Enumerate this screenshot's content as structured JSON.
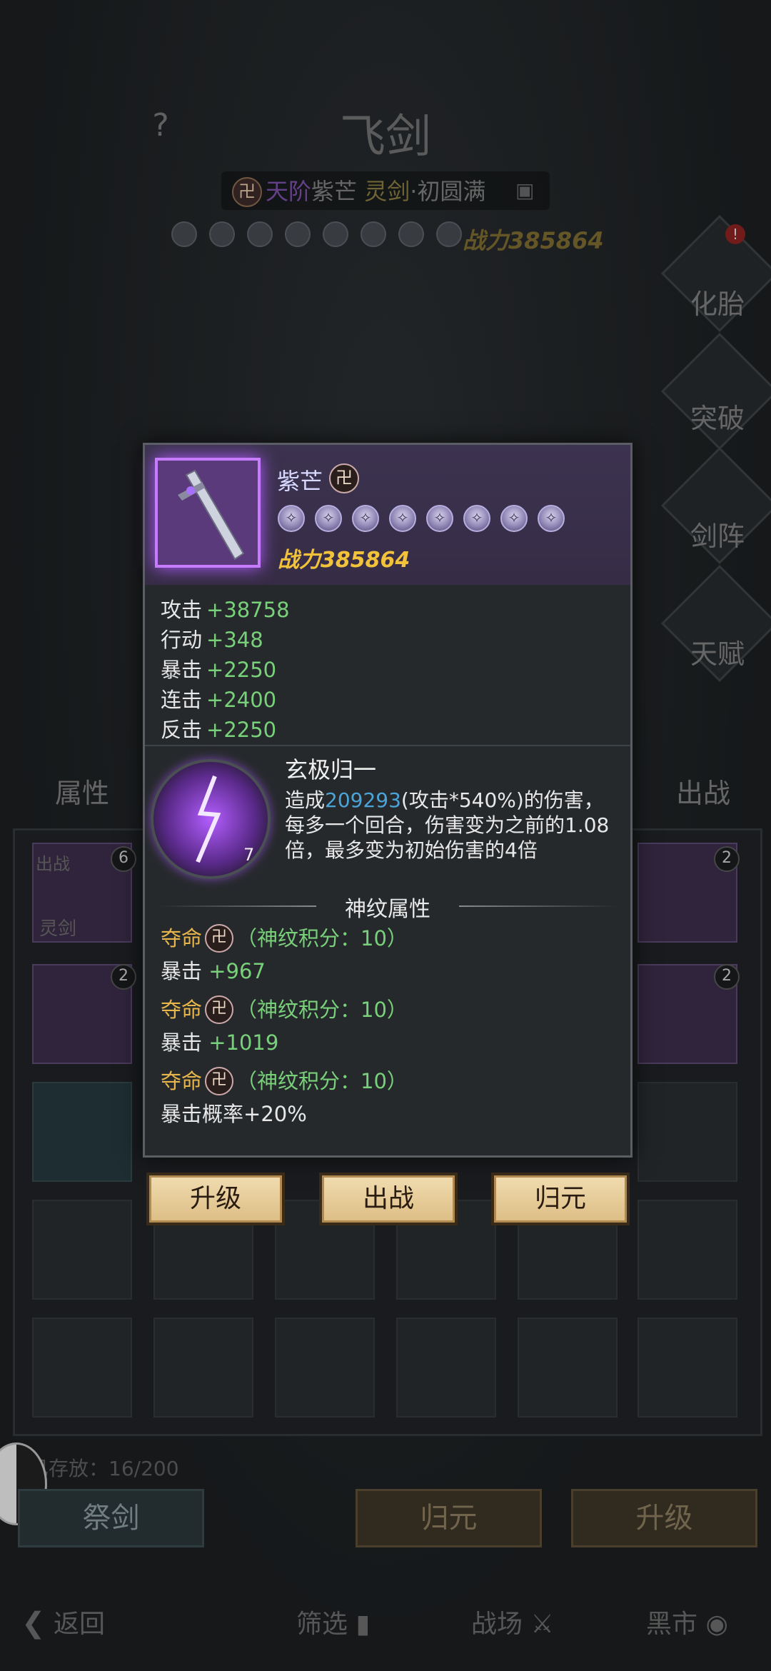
{
  "header": {
    "title": "飞剑",
    "help_label": "?",
    "rank_icon": "卍",
    "rank_parts": [
      "天阶",
      "紫芒",
      "灵剑",
      "·初圆满"
    ],
    "power": "战力385864"
  },
  "side_menu": [
    "化胎",
    "突破",
    "剑阵",
    "天赋"
  ],
  "tabs": {
    "left": "属性",
    "right": "出战"
  },
  "grid": {
    "slot_labels": [
      "出战",
      "灵剑"
    ],
    "badges": [
      "6",
      "2",
      "2",
      "2",
      "2",
      "2"
    ]
  },
  "storage": "已存放：16/200",
  "bottom_buttons": [
    "祭剑",
    "归元",
    "升级"
  ],
  "nav": [
    "返回",
    "筛选",
    "战场",
    "黑市"
  ],
  "popup": {
    "item": {
      "name": "紫芒",
      "icon_glyph": "卍",
      "stars_count": 8,
      "power": "战力385864"
    },
    "stats": [
      {
        "name": "攻击",
        "value": "+38758"
      },
      {
        "name": "行动",
        "value": "+348"
      },
      {
        "name": "暴击",
        "value": "+2250"
      },
      {
        "name": "连击",
        "value": "+2400"
      },
      {
        "name": "反击",
        "value": "+2250"
      }
    ],
    "skill": {
      "title": "玄极归一",
      "level": "7",
      "desc_prefix": "造成",
      "desc_value": "209293",
      "desc_suffix": "(攻击*540%)的伤害，每多一个回合，伤害变为之前的1.08倍，最多变为初始伤害的4倍"
    },
    "rune_section_title": "神纹属性",
    "runes": [
      {
        "name": "夺命",
        "score": "（神纹积分：10）",
        "stat": "暴击",
        "value": "+967"
      },
      {
        "name": "夺命",
        "score": "（神纹积分：10）",
        "stat": "暴击",
        "value": "+1019"
      },
      {
        "name": "夺命",
        "score": "（神纹积分：10）",
        "stat": "暴击概率",
        "value": "+20%"
      }
    ],
    "actions": [
      "升级",
      "出战",
      "归元"
    ]
  },
  "colors": {
    "accent_purple": "#c77bff",
    "stat_green": "#79d07a",
    "power_gold": "#f2c23a",
    "rune_gold": "#e8b54a",
    "highlight_blue": "#4aa4d8"
  }
}
